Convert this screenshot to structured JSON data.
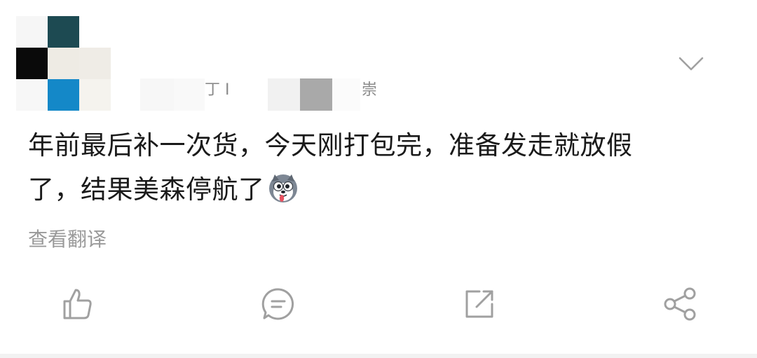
{
  "post": {
    "author_name_fragment_1": "丁 I",
    "author_name_fragment_2": "崇",
    "text_line_1": "年前最后补一次货，今天刚打包完，准备发走就放假",
    "text_line_2": "了，结果美森停航了",
    "emoji": "husky-dog-emoji",
    "translate_label": "查看翻译"
  },
  "actions": {
    "like": "thumbs-up-icon",
    "comment": "comment-icon",
    "share": "share-out-icon",
    "forward": "share-nodes-icon"
  },
  "colors": {
    "text": "#1a1a1a",
    "muted": "#9a9a9a",
    "icon": "#a0a0a0",
    "avatar_teal_dark": "#1d4a52",
    "avatar_black": "#0a0a0a",
    "avatar_blue": "#1488c8",
    "avatar_cream": "#eeebe4"
  }
}
